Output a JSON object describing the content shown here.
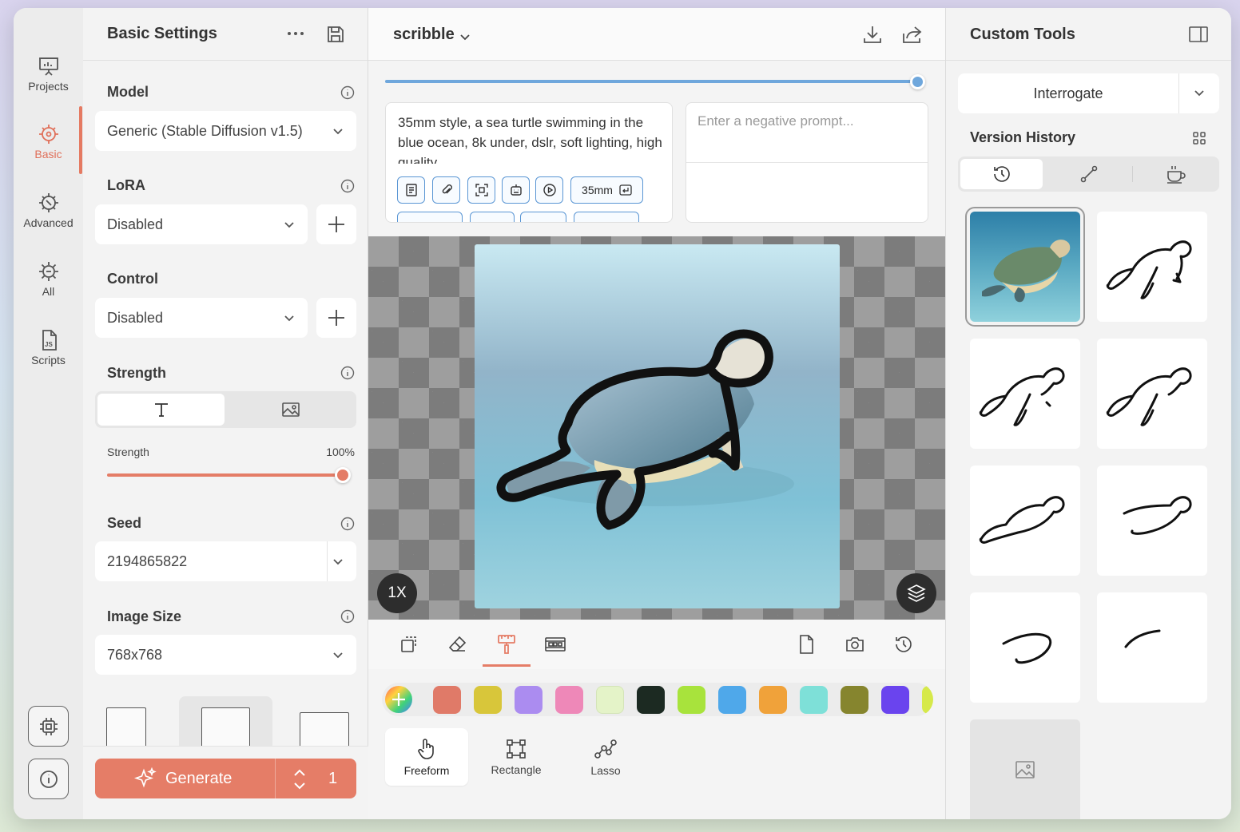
{
  "sidebar": {
    "items": [
      {
        "label": "Projects",
        "icon": "presentation-icon"
      },
      {
        "label": "Basic",
        "icon": "target-gear-icon"
      },
      {
        "label": "Advanced",
        "icon": "advanced-gear-icon"
      },
      {
        "label": "All",
        "icon": "sun-gear-icon"
      },
      {
        "label": "Scripts",
        "icon": "js-file-icon"
      }
    ],
    "active": "Basic",
    "bottom_icons": [
      "chip-icon",
      "info-icon"
    ]
  },
  "settings": {
    "title": "Basic Settings",
    "model": {
      "label": "Model",
      "value": "Generic (Stable Diffusion v1.5)"
    },
    "lora": {
      "label": "LoRA",
      "value": "Disabled"
    },
    "control": {
      "label": "Control",
      "value": "Disabled"
    },
    "strength": {
      "label": "Strength",
      "slider_label": "Strength",
      "slider_value": "100%",
      "percent": 100
    },
    "seed": {
      "label": "Seed",
      "value": "2194865822"
    },
    "image_size": {
      "label": "Image Size",
      "value": "768x768"
    },
    "generate": {
      "label": "Generate",
      "count": "1"
    }
  },
  "canvas": {
    "title": "scribble",
    "prompt": "35mm style, a sea turtle swimming in the blue ocean, 8k under, dslr, soft lighting, high quality",
    "negative_placeholder": "Enter a negative prompt...",
    "chip_label": "35mm",
    "zoom": "1X",
    "prompt_strength_fraction": 1.0
  },
  "palette": {
    "colors": [
      "#e07a68",
      "#d8c63a",
      "#ab8cf0",
      "#ee88b8",
      "#e4f3c8",
      "#1c2a22",
      "#a8e33c",
      "#4fa8ea",
      "#f0a23a",
      "#7ee0d8",
      "#86852e",
      "#6a44ee",
      "#d6e94a"
    ]
  },
  "modes": {
    "items": [
      {
        "label": "Freeform",
        "icon": "hand-pointer-icon"
      },
      {
        "label": "Rectangle",
        "icon": "rectangle-select-icon"
      },
      {
        "label": "Lasso",
        "icon": "lasso-icon"
      }
    ],
    "active": "Freeform"
  },
  "right": {
    "title": "Custom Tools",
    "interrogate": "Interrogate",
    "version_history": "Version History"
  }
}
